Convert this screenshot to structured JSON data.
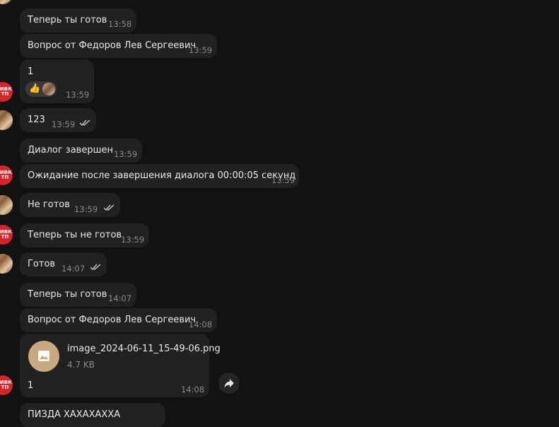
{
  "messages": [
    {
      "text": "Теперь ты готов",
      "time": "13:58"
    },
    {
      "text": "Вопрос от Федоров Лев Сергеевич",
      "time": "13:59"
    },
    {
      "text": "1",
      "time": "13:59",
      "reaction_emoji": "👍"
    },
    {
      "text": "123",
      "time": "13:59"
    },
    {
      "text": "Диалог завершен",
      "time": "13:59"
    },
    {
      "text": "Ожидание после завершения диалога 00:00:05 секунд",
      "time": "13:59"
    },
    {
      "text": "Не готов",
      "time": "13:59"
    },
    {
      "text": "Теперь ты не готов",
      "time": "13:59"
    },
    {
      "text": "Готов",
      "time": "14:07"
    },
    {
      "text": "Теперь ты готов",
      "time": "14:07"
    },
    {
      "text": "Вопрос от Федоров Лев Сергеевич",
      "time": "14:08"
    },
    {
      "file_name": "image_2024-06-11_15-49-06.png",
      "file_size": "4.7 KB",
      "text": "1",
      "time": "14:08"
    },
    {
      "text": "ПИЗДА ХАХАХАХХА"
    }
  ],
  "avatars": {
    "bot_label": "ЖИВКИ\nТП"
  },
  "colors": {
    "background": "#121212",
    "bubble": "#212121",
    "bot_avatar": "#d8232a",
    "file_icon": "#c7a87f",
    "time_text": "#8a8a8a"
  },
  "icons": {
    "read_receipt": "double-check-icon",
    "file": "image-file-icon",
    "forward": "forward-arrow-icon"
  }
}
